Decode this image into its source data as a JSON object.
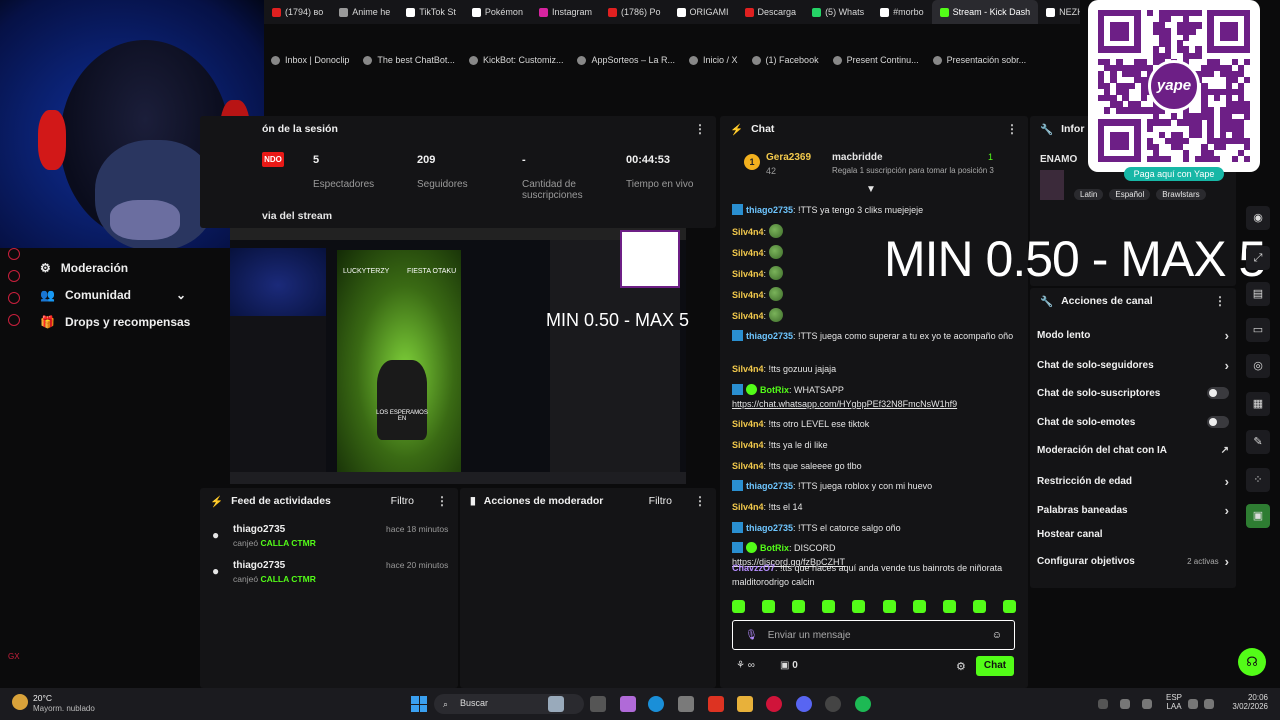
{
  "browser": {
    "tabs": [
      {
        "label": "(1794) во",
        "color": "#e02020"
      },
      {
        "label": "Anime he",
        "color": "#999999"
      },
      {
        "label": "TikTok St",
        "color": "#ffffff"
      },
      {
        "label": "Pokémon",
        "color": "#ffffff"
      },
      {
        "label": "Instagram",
        "color": "#d6249f"
      },
      {
        "label": "(1786) Po",
        "color": "#e02020"
      },
      {
        "label": "ORIGAMI",
        "color": "#ffffff"
      },
      {
        "label": "Descarga",
        "color": "#e02020"
      },
      {
        "label": "(5) Whats",
        "color": "#25d366"
      },
      {
        "label": "#morbo",
        "color": "#ffffff"
      },
      {
        "label": "Stream - Kick Dash",
        "color": "#53fc18",
        "active": true
      },
      {
        "label": "NEZHI",
        "color": "#ffffff"
      }
    ],
    "bookmarks": [
      {
        "label": "Inbox | Donoclip"
      },
      {
        "label": "The best ChatBot..."
      },
      {
        "label": "KickBot: Customiz..."
      },
      {
        "label": "AppSorteos – La R..."
      },
      {
        "label": "Inicio / X"
      },
      {
        "label": "(1) Facebook"
      },
      {
        "label": "Present Continu..."
      },
      {
        "label": "Presentación sobr..."
      }
    ]
  },
  "left_nav": {
    "items": [
      {
        "label": "Moderación"
      },
      {
        "label": "Comunidad"
      },
      {
        "label": "Drops y recompensas"
      }
    ],
    "footer": "GX"
  },
  "session": {
    "title": "ón de la sesión",
    "live_badge": "NDO",
    "stats": [
      {
        "value": "5",
        "label": "Espectadores"
      },
      {
        "value": "209",
        "label": "Seguidores"
      },
      {
        "value": "-",
        "label": "Cantidad de suscripciones"
      },
      {
        "value": "00:44:53",
        "label": "Tiempo en vivo"
      }
    ]
  },
  "preview": {
    "title": "via del stream",
    "overlay_small": "MIN 0.50 - MAX 5",
    "inner_tiktok_user": "LUCKYTERZY",
    "inner_tiktok_tag": "FIESTA OTAKU",
    "inner_caption": "LOS ESPERAMOS EN"
  },
  "feed": {
    "title": "Feed de actividades",
    "filter": "Filtro",
    "items": [
      {
        "user": "thiago2735",
        "action": "canjeó",
        "reward": "CALLA CTMR",
        "time": "hace 18 minutos"
      },
      {
        "user": "thiago2735",
        "action": "canjeó",
        "reward": "CALLA CTMR",
        "time": "hace 20 minutos"
      }
    ]
  },
  "mod_actions": {
    "title": "Acciones de moderador",
    "filter": "Filtro"
  },
  "chat": {
    "title": "Chat",
    "top_gifter": {
      "rank": "1",
      "name": "Gera2369",
      "count": "42"
    },
    "sub_goal": {
      "name": "macbridde",
      "count": "1",
      "text": "Regala 1 suscripción para tomar la posición 3"
    },
    "messages": [
      {
        "user": "thiago2735",
        "color": "#6ec6ff",
        "badge": "sq",
        "text": "!TTS ya tengo 3 cliks muejejeje"
      },
      {
        "user": "Silv4n4",
        "color": "#f2c94c",
        "badge": "",
        "text": "",
        "emote": true
      },
      {
        "user": "Silv4n4",
        "color": "#f2c94c",
        "badge": "",
        "text": "",
        "emote": true
      },
      {
        "user": "Silv4n4",
        "color": "#f2c94c",
        "badge": "",
        "text": "",
        "emote": true
      },
      {
        "user": "Silv4n4",
        "color": "#f2c94c",
        "badge": "",
        "text": "",
        "emote": true
      },
      {
        "user": "Silv4n4",
        "color": "#f2c94c",
        "badge": "",
        "text": "",
        "emote": true
      },
      {
        "user": "thiago2735",
        "color": "#6ec6ff",
        "badge": "sq",
        "text": "!TTS juega como superar a tu ex yo te acompaño oño"
      },
      {
        "user": "Silv4n4",
        "color": "#f2c94c",
        "badge": "",
        "text": "!tts gozuuu jajaja"
      },
      {
        "user": "BotRix",
        "color": "#53fc18",
        "badge": "bot",
        "text": "WHATSAPP",
        "link": "https://chat.whatsapp.com/HYgbpPEf32N8FmcNsW1hf9"
      },
      {
        "user": "Silv4n4",
        "color": "#f2c94c",
        "badge": "",
        "text": "!tts otro LEVEL ese tiktok"
      },
      {
        "user": "Silv4n4",
        "color": "#f2c94c",
        "badge": "",
        "text": "!tts ya le di like"
      },
      {
        "user": "Silv4n4",
        "color": "#f2c94c",
        "badge": "",
        "text": "!tts que saleeee go tlbo"
      },
      {
        "user": "thiago2735",
        "color": "#6ec6ff",
        "badge": "sq",
        "text": "!TTS juega roblox y con mi huevo"
      },
      {
        "user": "Silv4n4",
        "color": "#f2c94c",
        "badge": "",
        "text": "!tts el 14"
      },
      {
        "user": "thiago2735",
        "color": "#6ec6ff",
        "badge": "sq",
        "text": "!TTS el catorce salgo oño"
      },
      {
        "user": "BotRix",
        "color": "#53fc18",
        "badge": "bot",
        "text": "DISCORD",
        "link": "https://discord.gg/fzBpCZHT"
      },
      {
        "user": "ChavzzO7",
        "color": "#b58cff",
        "badge": "",
        "text": "!tts que haces aquí anda vende tus bainrots de niñorata malditorodrigo calcin"
      }
    ],
    "input_placeholder": "Enviar un mensaje",
    "points": "0",
    "send_label": "Chat"
  },
  "overlay_big": "MIN 0.50 - MAX 5",
  "info": {
    "title": "Infor",
    "streamer": "ENAMO",
    "tags": [
      "Latin",
      "Español",
      "Brawlstars"
    ]
  },
  "channel_actions": {
    "title": "Acciones de canal",
    "items": [
      {
        "label": "Modo lento",
        "control": "chevron"
      },
      {
        "label": "Chat de solo-seguidores",
        "control": "chevron"
      },
      {
        "label": "Chat de solo-suscriptores",
        "control": "toggle"
      },
      {
        "label": "Chat de solo-emotes",
        "control": "toggle"
      },
      {
        "label": "Moderación del chat con IA",
        "control": "external"
      },
      {
        "label": "Restricción de edad",
        "control": "chevron"
      },
      {
        "label": "Palabras baneadas",
        "control": "chevron"
      },
      {
        "label": "Hostear canal",
        "control": "none"
      },
      {
        "label": "Configurar objetivos",
        "control": "chevron",
        "extra": "2 activas"
      }
    ]
  },
  "qr": {
    "caption": "Paga aquí con Yape",
    "brand": "yape",
    "brand_color": "#6d1f86"
  },
  "taskbar": {
    "weather_temp": "20°C",
    "weather_desc": "Mayorm. nublado",
    "search": "Buscar",
    "lang": "ESP",
    "lang2": "LAA",
    "time": "20:06",
    "date": "3/02/2026"
  },
  "colors": {
    "accent": "#53fc18",
    "live": "#e91916",
    "panel": "#141416"
  }
}
